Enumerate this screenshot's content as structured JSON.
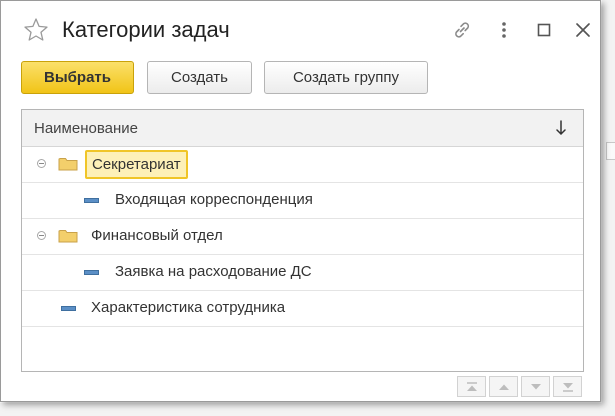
{
  "window": {
    "title": "Категории задач",
    "icons": [
      "star-icon",
      "link-icon",
      "more-vertical-icon",
      "maximize-icon",
      "close-icon"
    ]
  },
  "toolbar": {
    "select_label": "Выбрать",
    "create_label": "Создать",
    "create_group_label": "Создать группу"
  },
  "grid": {
    "column_header": "Наименование",
    "sort_icon": "sort-down-arrow-icon",
    "rows": [
      {
        "type": "group",
        "label": "Секретариат",
        "selected": true,
        "expanded": true,
        "level": 0
      },
      {
        "type": "item",
        "label": "Входящая корреспонденция",
        "level": 1
      },
      {
        "type": "group",
        "label": "Финансовый отдел",
        "selected": false,
        "expanded": true,
        "level": 0
      },
      {
        "type": "item",
        "label": "Заявка на расходование ДС",
        "level": 1
      },
      {
        "type": "item",
        "label": "Характеристика сотрудника",
        "level": 0
      }
    ]
  },
  "nav_buttons": [
    "first-page-icon",
    "previous-page-icon",
    "next-page-icon",
    "last-page-icon"
  ],
  "colors": {
    "primary_button": "#f4cf2d",
    "selection_border": "#f0c528",
    "selection_fill": "#fdf0b8",
    "folder": "#f0c550",
    "item_marker": "#5b8fc6"
  }
}
